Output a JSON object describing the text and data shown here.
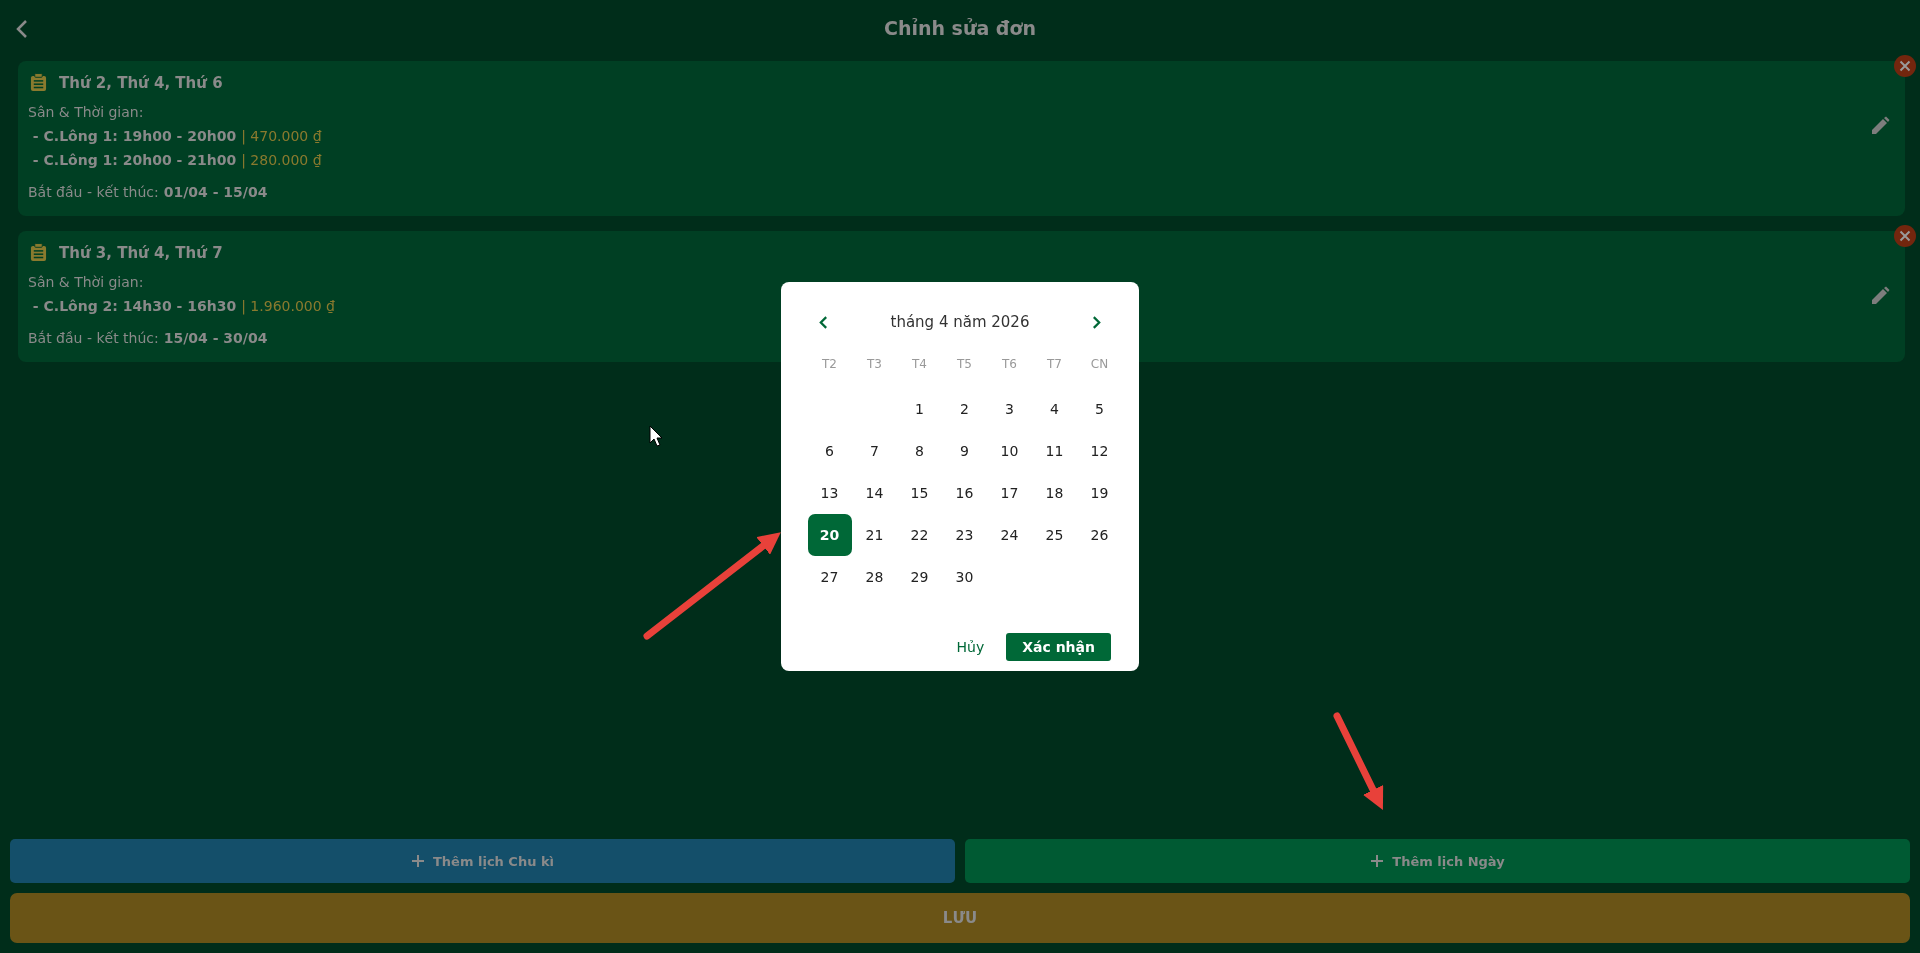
{
  "header": {
    "title": "Chỉnh sửa đơn"
  },
  "schedules": [
    {
      "days": "Thứ 2, Thứ 4, Thứ 6",
      "slots_label": "Sân & Thời gian:",
      "slots": [
        {
          "text": " - C.Lông 1: 19h00 - 20h00",
          "price": "| 470.000 ₫"
        },
        {
          "text": " - C.Lông 1: 20h00 - 21h00",
          "price": "| 280.000 ₫"
        }
      ],
      "range_label": "Bắt đầu - kết thúc:",
      "range": "01/04 - 15/04"
    },
    {
      "days": "Thứ 3, Thứ 4, Thứ 7",
      "slots_label": "Sân & Thời gian:",
      "slots": [
        {
          "text": " - C.Lông 2: 14h30 - 16h30",
          "price": "| 1.960.000 ₫"
        }
      ],
      "range_label": "Bắt đầu - kết thúc:",
      "range": "15/04 - 30/04"
    }
  ],
  "calendar": {
    "title": "tháng 4 năm 2026",
    "weekdays": [
      "T2",
      "T3",
      "T4",
      "T5",
      "T6",
      "T7",
      "CN"
    ],
    "weeks": [
      [
        {
          "label": "1",
          "selected": false
        },
        {
          "label": "2",
          "selected": false
        },
        {
          "label": "3",
          "selected": false
        },
        {
          "label": "4",
          "selected": false
        },
        {
          "label": "5",
          "selected": false
        }
      ],
      [
        {
          "label": "6",
          "selected": false
        },
        {
          "label": "7",
          "selected": false
        },
        {
          "label": "8",
          "selected": false
        },
        {
          "label": "9",
          "selected": false
        },
        {
          "label": "10",
          "selected": false
        },
        {
          "label": "11",
          "selected": false
        },
        {
          "label": "12",
          "selected": false
        }
      ],
      [
        {
          "label": "13",
          "selected": false
        },
        {
          "label": "14",
          "selected": false
        },
        {
          "label": "15",
          "selected": false
        },
        {
          "label": "16",
          "selected": false
        },
        {
          "label": "17",
          "selected": false
        },
        {
          "label": "18",
          "selected": false
        },
        {
          "label": "19",
          "selected": false
        }
      ],
      [
        {
          "label": "20",
          "selected": true
        },
        {
          "label": "21",
          "selected": false
        },
        {
          "label": "22",
          "selected": false
        },
        {
          "label": "23",
          "selected": false
        },
        {
          "label": "24",
          "selected": false
        },
        {
          "label": "25",
          "selected": false
        },
        {
          "label": "26",
          "selected": false
        }
      ],
      [
        {
          "label": "27",
          "selected": false
        },
        {
          "label": "28",
          "selected": false
        },
        {
          "label": "29",
          "selected": false
        },
        {
          "label": "30",
          "selected": false
        }
      ]
    ],
    "cancel": "Hủy",
    "confirm": "Xác nhận"
  },
  "actions": [
    {
      "kind": "cycle",
      "label": "Thêm lịch Chu kì"
    },
    {
      "kind": "day",
      "label": "Thêm lịch Ngày"
    }
  ],
  "save": "LƯU"
}
